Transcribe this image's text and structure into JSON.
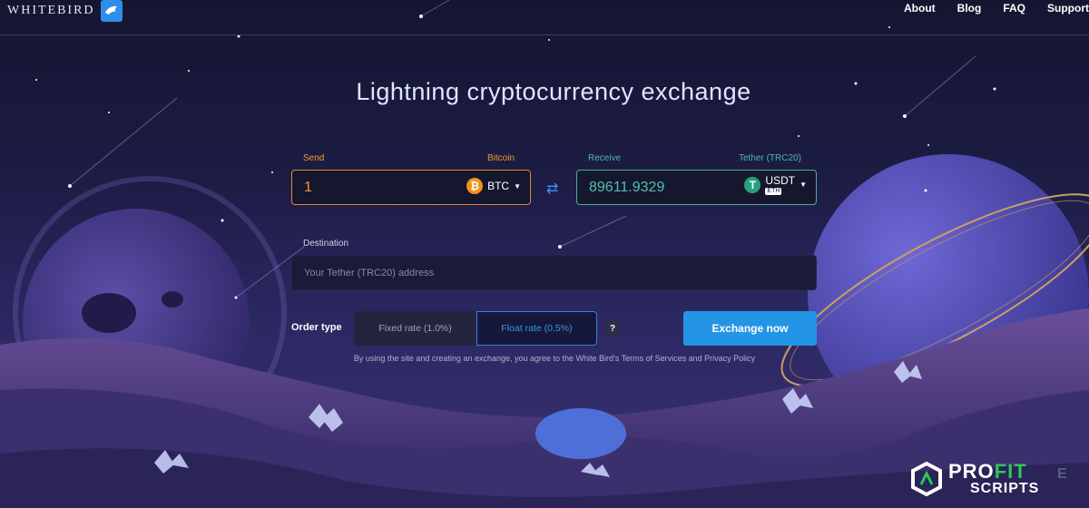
{
  "header": {
    "logo_text": "WHITEBIRD",
    "nav": [
      "About",
      "Blog",
      "FAQ",
      "Support"
    ]
  },
  "title": "Lightning cryptocurrency exchange",
  "send": {
    "label": "Send",
    "currency_name": "Bitcoin",
    "amount": "1",
    "currency_code": "BTC",
    "coin_symbol": "₿"
  },
  "receive": {
    "label": "Receive",
    "currency_name": "Tether (TRC20)",
    "amount": "89611.9329",
    "currency_code": "USDT",
    "network_badge": "ETH",
    "coin_symbol": "T"
  },
  "destination": {
    "label": "Destination",
    "placeholder": "Your Tether (TRC20) address"
  },
  "order": {
    "label": "Order type",
    "fixed": "Fixed rate (1.0%)",
    "float": "Float rate (0.5%)",
    "help": "?",
    "selected": "float"
  },
  "submit_label": "Exchange now",
  "terms": "By using the site and creating an exchange, you agree to the White Bird's Terms of Services and Privacy Policy",
  "watermark": {
    "line1_a": "PRO",
    "line1_b": "FIT",
    "line2": "SCRIPTS",
    "ghost": "E"
  },
  "colors": {
    "send_accent": "#f29b2b",
    "receive_accent": "#4fb9a6",
    "primary": "#2495e6"
  }
}
